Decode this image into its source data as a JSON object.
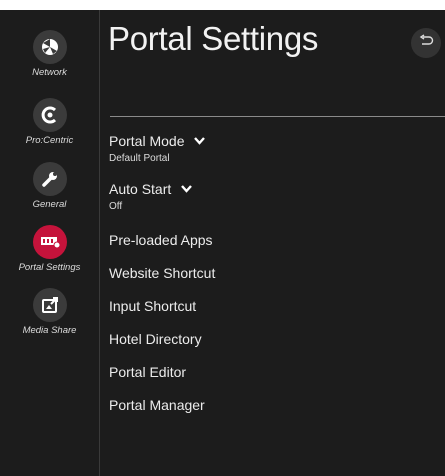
{
  "sidebar": {
    "items": [
      {
        "label": "Network",
        "icon": "network-icon"
      },
      {
        "label": "Pro:Centric",
        "icon": "procentric-icon"
      },
      {
        "label": "General",
        "icon": "wrench-icon"
      },
      {
        "label": "Portal Settings",
        "icon": "portal-icon",
        "active": true
      },
      {
        "label": "Media Share",
        "icon": "media-share-icon"
      }
    ]
  },
  "header": {
    "title": "Portal Settings",
    "back_icon": "back-arrow-icon"
  },
  "menu": {
    "portal_mode": {
      "label": "Portal Mode",
      "value": "Default Portal"
    },
    "auto_start": {
      "label": "Auto Start",
      "value": "Off"
    },
    "preloaded_apps": "Pre-loaded Apps",
    "website_shortcut": "Website Shortcut",
    "input_shortcut": "Input Shortcut",
    "hotel_directory": "Hotel Directory",
    "portal_editor": "Portal Editor",
    "portal_manager": "Portal Manager"
  },
  "colors": {
    "background": "#1c1c1c",
    "icon_circle": "#3b3b3b",
    "accent_active": "#c5133b",
    "text": "#ececec"
  }
}
